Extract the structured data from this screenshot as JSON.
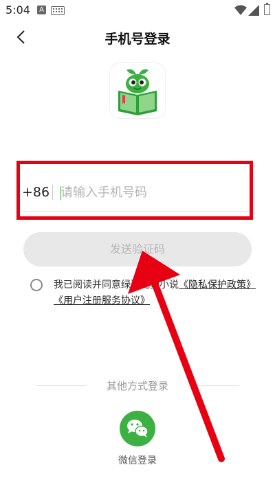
{
  "status_bar": {
    "time": "5:04",
    "app_icon_letter": "A"
  },
  "header": {
    "title": "手机号登录",
    "back_icon": "chevron-left-icon"
  },
  "logo": {
    "name": "app-logo-icon"
  },
  "phone": {
    "country_code": "+86",
    "placeholder": "请输入手机号码",
    "value": ""
  },
  "send_code": {
    "label": "发送验证码"
  },
  "agreement": {
    "prefix": "我已阅读并同意绿豆免费小说",
    "privacy_link": "《隐私保护政策》",
    "user_link": "《用户注册服务协议》",
    "checked": false
  },
  "other_login": {
    "title": "其他方式登录",
    "wechat_label": "微信登录",
    "wechat_icon": "wechat-icon"
  },
  "colors": {
    "accent_green": "#3cb043",
    "highlight_red": "#e60012"
  }
}
